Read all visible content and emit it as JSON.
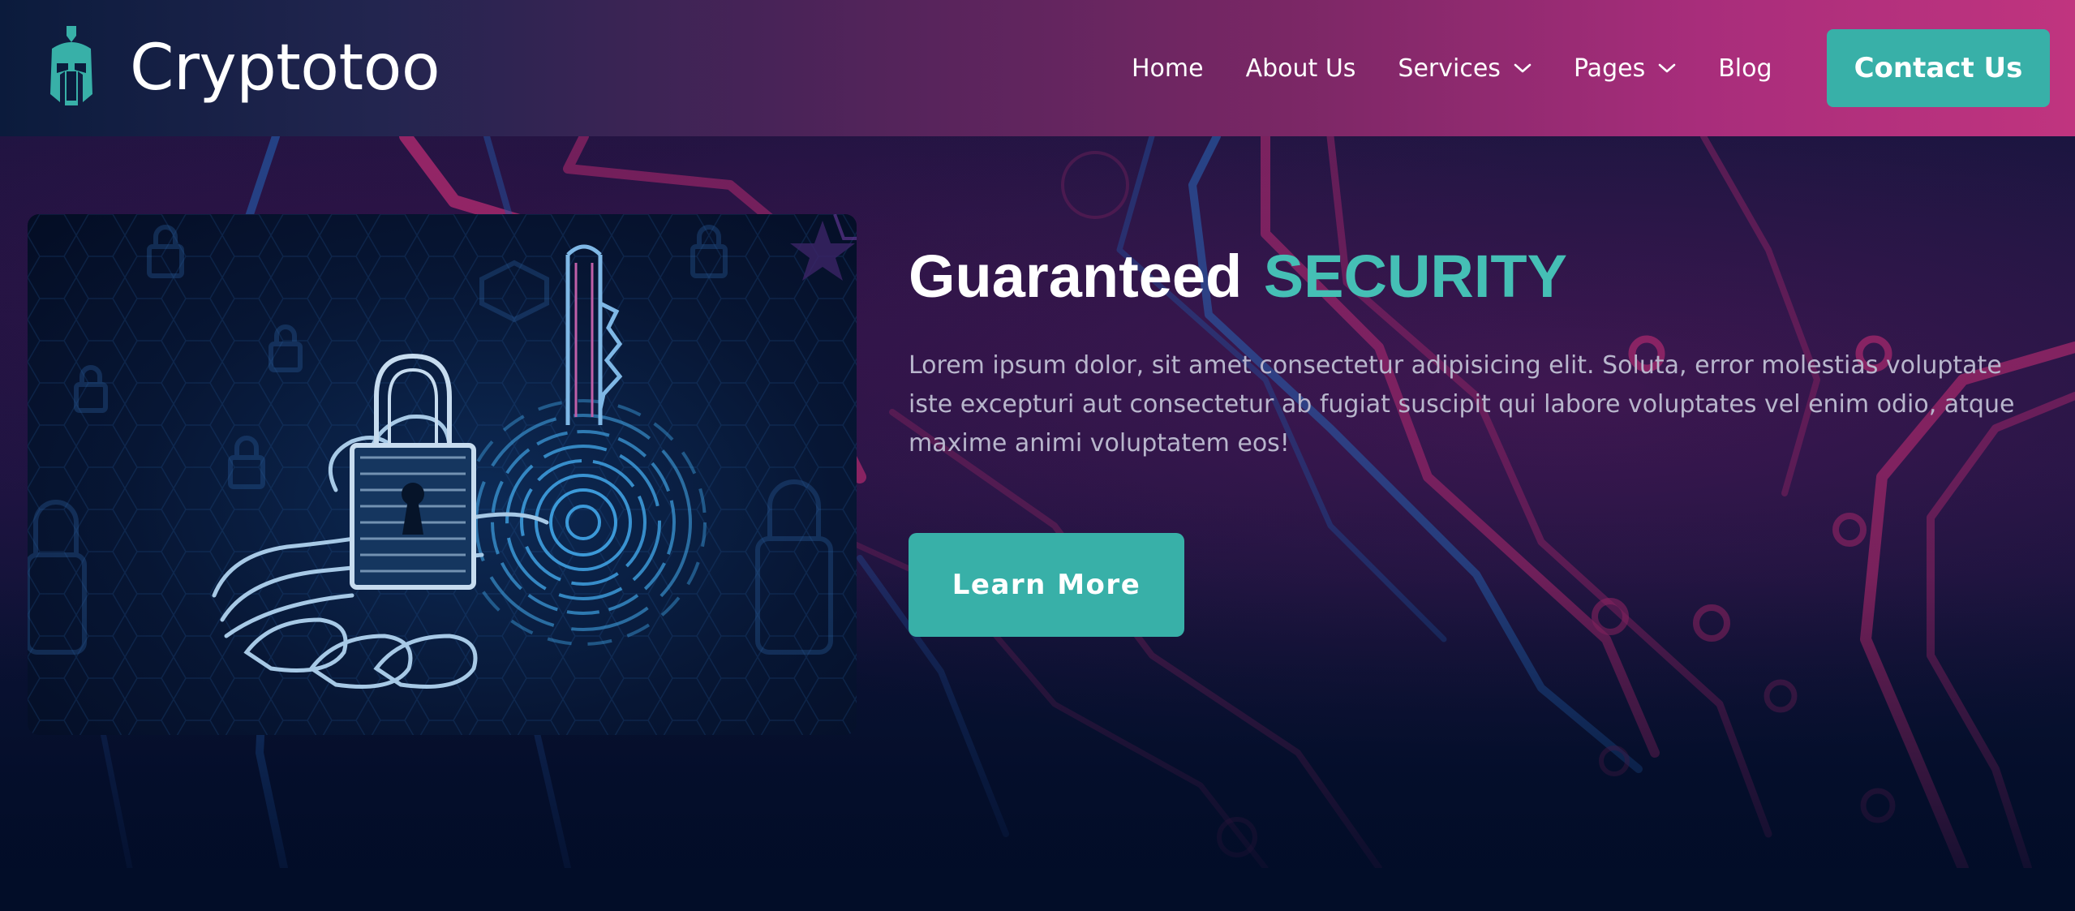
{
  "navbar": {
    "brand_name": "Cryptotoo",
    "logo_icon": "spartan-helmet-icon",
    "menu": [
      {
        "label": "Home",
        "dropdown": false
      },
      {
        "label": "About Us",
        "dropdown": false
      },
      {
        "label": "Services",
        "dropdown": true
      },
      {
        "label": "Pages",
        "dropdown": true
      },
      {
        "label": "Blog",
        "dropdown": false
      }
    ],
    "cta_label": "Contact Us"
  },
  "hero": {
    "title": "Guaranteed",
    "title_accent": "SECURITY",
    "description": "Lorem ipsum dolor, sit amet consectetur adipisicing elit. Soluta, error molestias voluptate iste excepturi aut consectetur ab fugiat suscipit qui labore voluptates vel enim odio, atque maxime animi voluptatem eos!",
    "button_label": "Learn More",
    "image_subject": "padlock-key-fingerprint-hand-illustration"
  },
  "colors": {
    "accent": "#38b0a8",
    "accent_text": "#45bfb5",
    "nav_gradient_start": "#0b1b3c",
    "nav_gradient_end": "#c0347f",
    "background": "#020d28",
    "body_text": "#b8b6cc"
  }
}
